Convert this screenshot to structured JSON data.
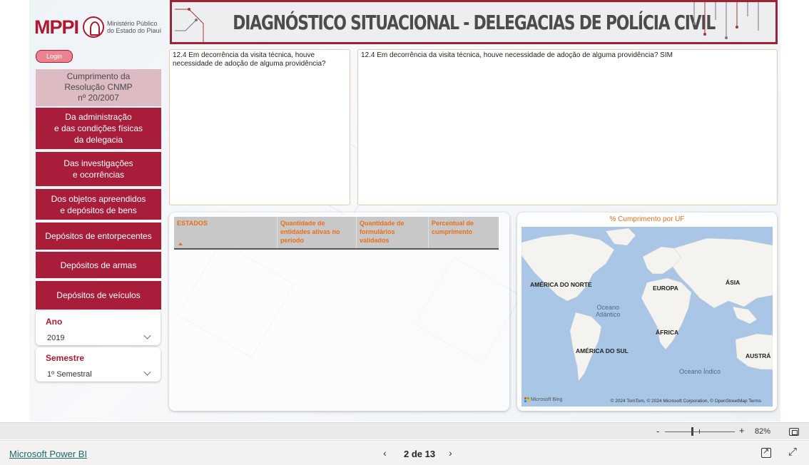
{
  "logo": {
    "mark": "MPPI",
    "text_line1": "Ministério Público",
    "text_line2": "do Estado do Piauí"
  },
  "banner": {
    "title": "DIAGNÓSTICO SITUACIONAL - DELEGACIAS DE POLÍCIA CIVIL"
  },
  "sidebar": {
    "login": "Login",
    "cnmp": "Cumprimento da\nResolução CNMP\nnº 20/2007",
    "items": [
      {
        "label": "Da administração\ne das condições físicas\nda delegacia"
      },
      {
        "label": "Das investigações\ne ocorrências"
      },
      {
        "label": "Dos objetos apreendidos\ne depósitos de bens"
      },
      {
        "label": "Depósitos de entorpecentes"
      },
      {
        "label": "Depósitos de armas"
      },
      {
        "label": "Depósitos de veículos"
      }
    ]
  },
  "filters": {
    "year": {
      "label": "Ano",
      "value": "2019"
    },
    "semester": {
      "label": "Semestre",
      "value": "1º Semestral"
    }
  },
  "question_panel": {
    "text": "12.4 Em decorrência da visita técnica, houve necessidade de adoção de alguma providência?"
  },
  "answer_panel": {
    "text": "12.4 Em decorrência da visita técnica, houve necessidade de adoção de alguma providência? SIM"
  },
  "table": {
    "columns": [
      "ESTADOS",
      "Quantidade de entidades ativas no período",
      "Quantidade de formulários validados",
      "Percentual de cumprimento"
    ],
    "rows": []
  },
  "map": {
    "title": "% Cumprimento  por UF",
    "labels": {
      "north_america": "AMÉRICA DO NORTE",
      "europe": "EUROPA",
      "asia": "ÁSIA",
      "atlantic": "Oceano\nAtlântico",
      "africa": "ÁFRICA",
      "south_america": "AMÉRICA DO SUL",
      "australia": "AUSTRÁ",
      "indian": "Oceano Índico"
    },
    "provider": "Microsoft Bing",
    "attribution": "© 2024 TomTom, © 2024 Microsoft Corporation, © OpenStreetMap  Terms"
  },
  "zoom": {
    "minus": "-",
    "plus": "+",
    "percent": "82%",
    "level": 0.82
  },
  "footer": {
    "link": "Microsoft Power BI",
    "prev": "‹",
    "page": "2 de 13",
    "next": "›",
    "expand": "⤢"
  },
  "colors": {
    "brand": "#b0182f",
    "nav": "#a81d3a",
    "accent": "#e8701a",
    "map_water": "#a9c6e6"
  }
}
